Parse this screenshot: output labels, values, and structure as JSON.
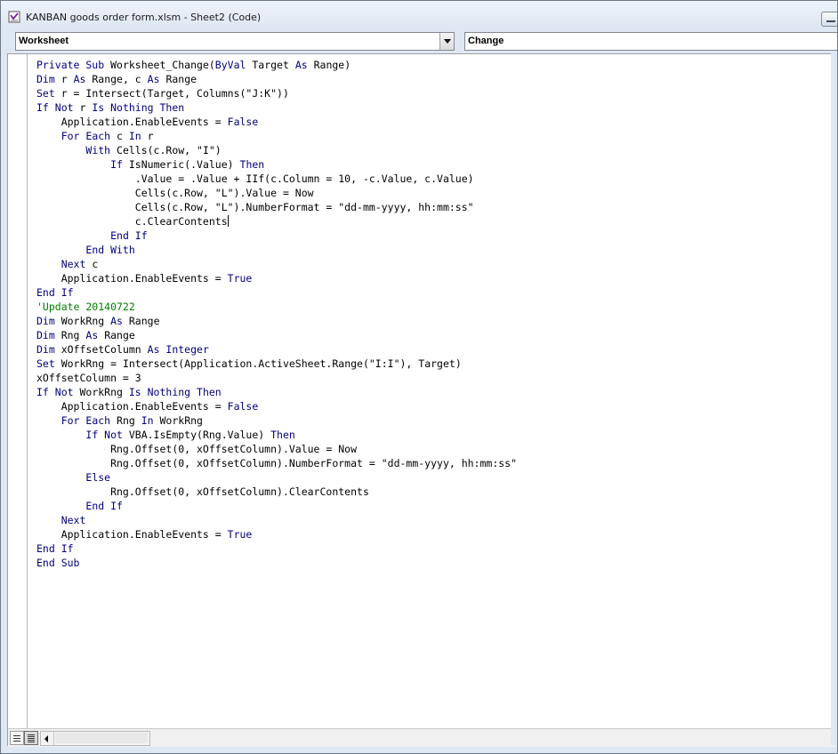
{
  "window": {
    "title": "KANBAN goods order form.xlsm - Sheet2 (Code)"
  },
  "object_combo": {
    "value": "Worksheet"
  },
  "procedure_combo": {
    "value": "Change"
  },
  "code_lines": [
    [
      {
        "t": "Private Sub",
        "k": 1
      },
      {
        "t": " Worksheet_Change("
      },
      {
        "t": "ByVal",
        "k": 1
      },
      {
        "t": " Target "
      },
      {
        "t": "As",
        "k": 1
      },
      {
        "t": " Range)"
      }
    ],
    [
      {
        "t": "Dim",
        "k": 1
      },
      {
        "t": " r "
      },
      {
        "t": "As",
        "k": 1
      },
      {
        "t": " Range, c "
      },
      {
        "t": "As",
        "k": 1
      },
      {
        "t": " Range"
      }
    ],
    [
      {
        "t": "Set",
        "k": 1
      },
      {
        "t": " r = Intersect(Target, Columns(\"J:K\"))"
      }
    ],
    [
      {
        "t": "If Not",
        "k": 1
      },
      {
        "t": " r "
      },
      {
        "t": "Is Nothing Then",
        "k": 1
      }
    ],
    [
      {
        "t": "    Application.EnableEvents = "
      },
      {
        "t": "False",
        "k": 1
      }
    ],
    [
      {
        "t": "    "
      },
      {
        "t": "For Each",
        "k": 1
      },
      {
        "t": " c "
      },
      {
        "t": "In",
        "k": 1
      },
      {
        "t": " r"
      }
    ],
    [
      {
        "t": "        "
      },
      {
        "t": "With",
        "k": 1
      },
      {
        "t": " Cells(c.Row, \"I\")"
      }
    ],
    [
      {
        "t": "            "
      },
      {
        "t": "If",
        "k": 1
      },
      {
        "t": " IsNumeric(.Value) "
      },
      {
        "t": "Then",
        "k": 1
      }
    ],
    [
      {
        "t": "                .Value = .Value + IIf(c.Column = 10, -c.Value, c.Value)"
      }
    ],
    [
      {
        "t": "                Cells(c.Row, \"L\").Value = Now"
      }
    ],
    [
      {
        "t": "                Cells(c.Row, \"L\").NumberFormat = \"dd-mm-yyyy, hh:mm:ss\""
      }
    ],
    [
      {
        "t": "                c.ClearContents"
      },
      {
        "caret": 1
      }
    ],
    [
      {
        "t": "            "
      },
      {
        "t": "End If",
        "k": 1
      }
    ],
    [
      {
        "t": "        "
      },
      {
        "t": "End With",
        "k": 1
      }
    ],
    [
      {
        "t": "    "
      },
      {
        "t": "Next",
        "k": 1
      },
      {
        "t": " c"
      }
    ],
    [
      {
        "t": "    Application.EnableEvents = "
      },
      {
        "t": "True",
        "k": 1
      }
    ],
    [
      {
        "t": "End If",
        "k": 1
      }
    ],
    [
      {
        "t": "'Update 20140722",
        "c": 1
      }
    ],
    [
      {
        "t": "Dim",
        "k": 1
      },
      {
        "t": " WorkRng "
      },
      {
        "t": "As",
        "k": 1
      },
      {
        "t": " Range"
      }
    ],
    [
      {
        "t": "Dim",
        "k": 1
      },
      {
        "t": " Rng "
      },
      {
        "t": "As",
        "k": 1
      },
      {
        "t": " Range"
      }
    ],
    [
      {
        "t": "Dim",
        "k": 1
      },
      {
        "t": " xOffsetColumn "
      },
      {
        "t": "As Integer",
        "k": 1
      }
    ],
    [
      {
        "t": "Set",
        "k": 1
      },
      {
        "t": " WorkRng = Intersect(Application.ActiveSheet.Range(\"I:I\"), Target)"
      }
    ],
    [
      {
        "t": "xOffsetColumn = 3"
      }
    ],
    [
      {
        "t": "If Not",
        "k": 1
      },
      {
        "t": " WorkRng "
      },
      {
        "t": "Is Nothing Then",
        "k": 1
      }
    ],
    [
      {
        "t": "    Application.EnableEvents = "
      },
      {
        "t": "False",
        "k": 1
      }
    ],
    [
      {
        "t": "    "
      },
      {
        "t": "For Each",
        "k": 1
      },
      {
        "t": " Rng "
      },
      {
        "t": "In",
        "k": 1
      },
      {
        "t": " WorkRng"
      }
    ],
    [
      {
        "t": "        "
      },
      {
        "t": "If Not",
        "k": 1
      },
      {
        "t": " VBA.IsEmpty(Rng.Value) "
      },
      {
        "t": "Then",
        "k": 1
      }
    ],
    [
      {
        "t": "            Rng.Offset(0, xOffsetColumn).Value = Now"
      }
    ],
    [
      {
        "t": "            Rng.Offset(0, xOffsetColumn).NumberFormat = \"dd-mm-yyyy, hh:mm:ss\""
      }
    ],
    [
      {
        "t": "        "
      },
      {
        "t": "Else",
        "k": 1
      }
    ],
    [
      {
        "t": "            Rng.Offset(0, xOffsetColumn).ClearContents"
      }
    ],
    [
      {
        "t": "        "
      },
      {
        "t": "End If",
        "k": 1
      }
    ],
    [
      {
        "t": "    "
      },
      {
        "t": "Next",
        "k": 1
      }
    ],
    [
      {
        "t": "    Application.EnableEvents = "
      },
      {
        "t": "True",
        "k": 1
      }
    ],
    [
      {
        "t": "End If",
        "k": 1
      }
    ],
    [
      {
        "t": "End Sub",
        "k": 1
      }
    ]
  ],
  "colors": {
    "keyword": "#00007f",
    "comment": "#008000",
    "text": "#000000"
  },
  "icons": {
    "app": "vba-module-icon",
    "procedure_view": "procedure-view-icon",
    "full_module_view": "full-module-view-icon",
    "scroll_left": "arrow-left-icon"
  }
}
